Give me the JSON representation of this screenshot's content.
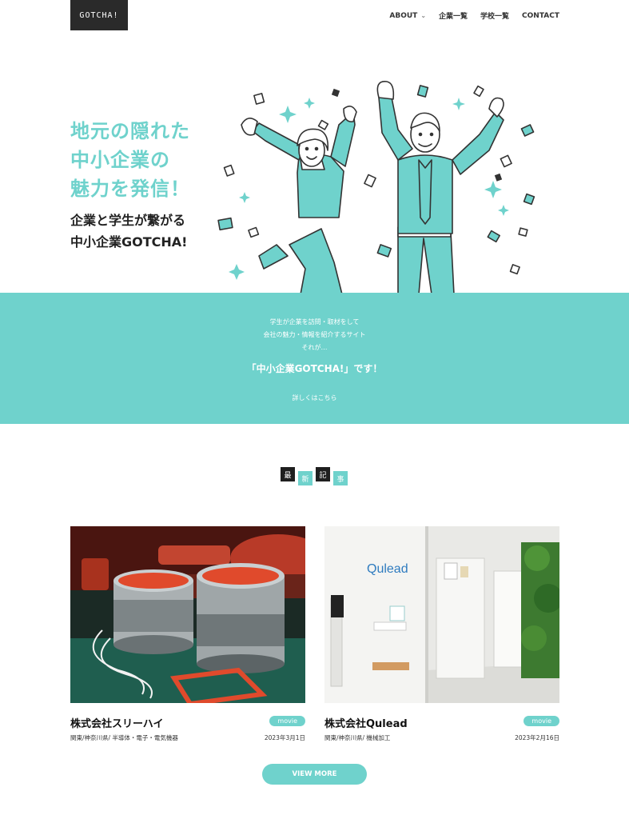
{
  "header": {
    "logo_text": "GOTCHA!",
    "nav": [
      {
        "label": "ABOUT"
      },
      {
        "label": "企業一覧"
      },
      {
        "label": "学校一覧"
      },
      {
        "label": "CONTACT"
      }
    ]
  },
  "hero": {
    "heading_lines": [
      "地元の隠れた",
      "中小企業の",
      "魅力を発信！"
    ],
    "sub_lines": [
      "企業と学生が繋がる",
      "中小企業GOTCHA!"
    ]
  },
  "band": {
    "lines": [
      "学生が企業を訪問・取材をして",
      "会社の魅力・情報を紹介するサイト",
      "それが…"
    ],
    "highlight": "「中小企業GOTCHA!」です！",
    "more_link": "詳しくはこちら"
  },
  "latest": {
    "chars": [
      "最",
      "新",
      "記",
      "事"
    ]
  },
  "articles": [
    {
      "title": "株式会社スリーハイ",
      "badge": "movie",
      "category": "関東/神奈川県/ 半導体・電子・電気機器",
      "date": "2023年3月1日"
    },
    {
      "title": "株式会社Qulead",
      "badge": "movie",
      "category": "関東/神奈川県/ 機械加工",
      "date": "2023年2月16日",
      "sign_text": "Qulead"
    }
  ],
  "view_more": "VIEW MORE",
  "colors": {
    "accent": "#6fd2cc",
    "dark": "#2a2a2a"
  }
}
